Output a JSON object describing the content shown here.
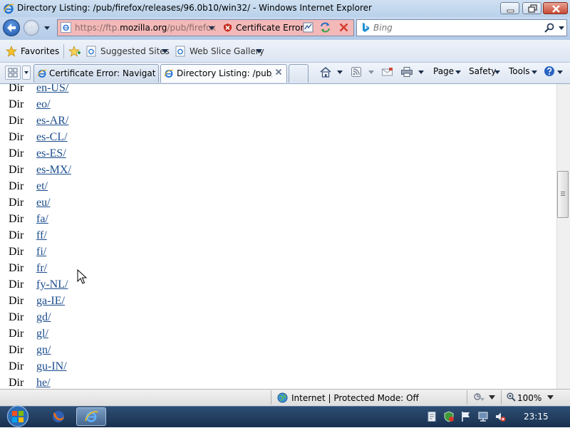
{
  "window": {
    "title": "Directory Listing: /pub/firefox/releases/96.0b10/win32/ - Windows Internet Explorer"
  },
  "address_bar": {
    "scheme": "https://ftp.",
    "host": "mozilla.org",
    "path": "/pub/firefox",
    "cert_error": "Certificate Error"
  },
  "search": {
    "placeholder": "Bing"
  },
  "favorites_bar": {
    "favorites": "Favorites",
    "suggested_sites": "Suggested Sites",
    "web_slice_gallery": "Web Slice Gallery"
  },
  "tabs": [
    {
      "label": "Certificate Error: Navigatio...",
      "active": false
    },
    {
      "label": "Directory Listing: /pub/...",
      "active": true
    }
  ],
  "command_bar": {
    "page": "Page",
    "safety": "Safety",
    "tools": "Tools"
  },
  "listing": [
    {
      "type": "Dir",
      "name": "en-US/"
    },
    {
      "type": "Dir",
      "name": "eo/"
    },
    {
      "type": "Dir",
      "name": "es-AR/"
    },
    {
      "type": "Dir",
      "name": "es-CL/"
    },
    {
      "type": "Dir",
      "name": "es-ES/"
    },
    {
      "type": "Dir",
      "name": "es-MX/"
    },
    {
      "type": "Dir",
      "name": "et/"
    },
    {
      "type": "Dir",
      "name": "eu/"
    },
    {
      "type": "Dir",
      "name": "fa/"
    },
    {
      "type": "Dir",
      "name": "ff/"
    },
    {
      "type": "Dir",
      "name": "fi/"
    },
    {
      "type": "Dir",
      "name": "fr/"
    },
    {
      "type": "Dir",
      "name": "fy-NL/"
    },
    {
      "type": "Dir",
      "name": "ga-IE/"
    },
    {
      "type": "Dir",
      "name": "gd/"
    },
    {
      "type": "Dir",
      "name": "gl/"
    },
    {
      "type": "Dir",
      "name": "gn/"
    },
    {
      "type": "Dir",
      "name": "gu-IN/"
    },
    {
      "type": "Dir",
      "name": "he/"
    }
  ],
  "status_bar": {
    "zone": "Internet | Protected Mode: Off",
    "zoom": "100%"
  },
  "taskbar": {
    "clock": "23:15"
  },
  "colors": {
    "link": "#1a4c8c",
    "cert_error_bg": "#f3b9b9",
    "taskbar": "#19314f"
  }
}
